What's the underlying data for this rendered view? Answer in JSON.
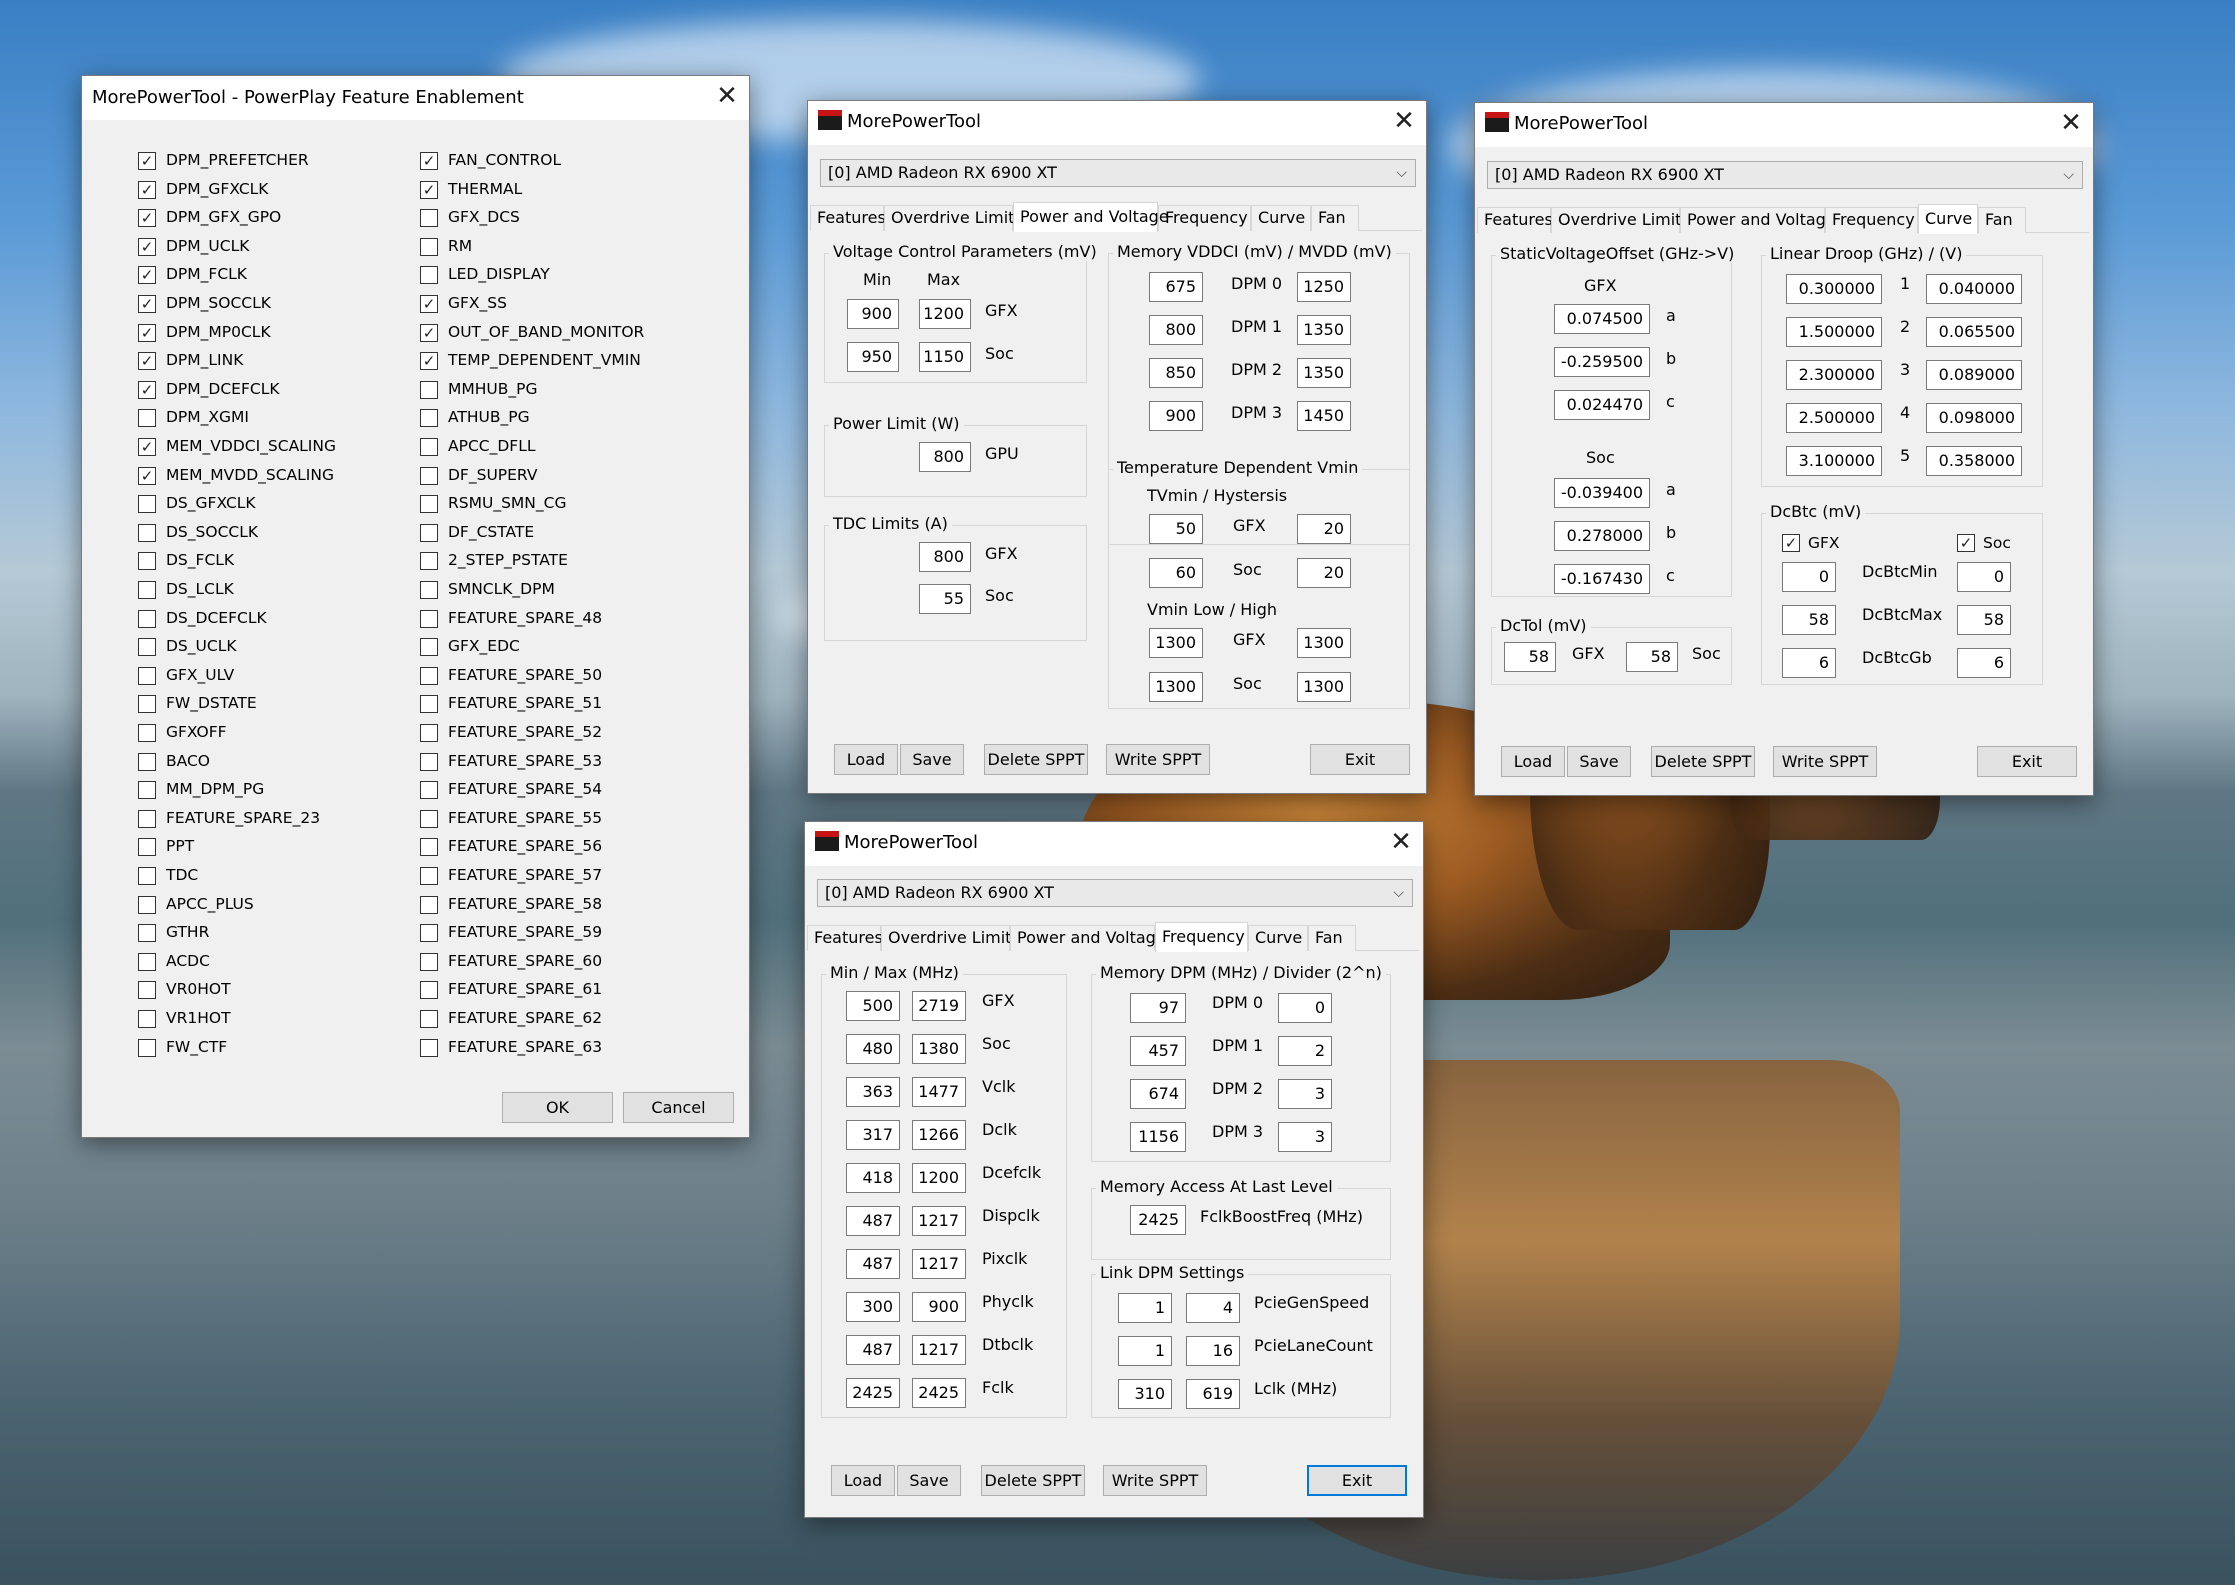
{
  "feat": {
    "title": "MorePowerTool - PowerPlay Feature Enablement",
    "ok": "OK",
    "cancel": "Cancel",
    "left": [
      [
        "DPM_PREFETCHER",
        true
      ],
      [
        "DPM_GFXCLK",
        true
      ],
      [
        "DPM_GFX_GPO",
        true
      ],
      [
        "DPM_UCLK",
        true
      ],
      [
        "DPM_FCLK",
        true
      ],
      [
        "DPM_SOCCLK",
        true
      ],
      [
        "DPM_MP0CLK",
        true
      ],
      [
        "DPM_LINK",
        true
      ],
      [
        "DPM_DCEFCLK",
        true
      ],
      [
        "DPM_XGMI",
        false
      ],
      [
        "MEM_VDDCI_SCALING",
        true
      ],
      [
        "MEM_MVDD_SCALING",
        true
      ],
      [
        "DS_GFXCLK",
        false
      ],
      [
        "DS_SOCCLK",
        false
      ],
      [
        "DS_FCLK",
        false
      ],
      [
        "DS_LCLK",
        false
      ],
      [
        "DS_DCEFCLK",
        false
      ],
      [
        "DS_UCLK",
        false
      ],
      [
        "GFX_ULV",
        false
      ],
      [
        "FW_DSTATE",
        false
      ],
      [
        "GFXOFF",
        false
      ],
      [
        "BACO",
        false
      ],
      [
        "MM_DPM_PG",
        false
      ],
      [
        "FEATURE_SPARE_23",
        false
      ],
      [
        "PPT",
        false
      ],
      [
        "TDC",
        false
      ],
      [
        "APCC_PLUS",
        false
      ],
      [
        "GTHR",
        false
      ],
      [
        "ACDC",
        false
      ],
      [
        "VR0HOT",
        false
      ],
      [
        "VR1HOT",
        false
      ],
      [
        "FW_CTF",
        false
      ]
    ],
    "right": [
      [
        "FAN_CONTROL",
        true
      ],
      [
        "THERMAL",
        true
      ],
      [
        "GFX_DCS",
        false
      ],
      [
        "RM",
        false
      ],
      [
        "LED_DISPLAY",
        false
      ],
      [
        "GFX_SS",
        true
      ],
      [
        "OUT_OF_BAND_MONITOR",
        true
      ],
      [
        "TEMP_DEPENDENT_VMIN",
        true
      ],
      [
        "MMHUB_PG",
        false
      ],
      [
        "ATHUB_PG",
        false
      ],
      [
        "APCC_DFLL",
        false
      ],
      [
        "DF_SUPERV",
        false
      ],
      [
        "RSMU_SMN_CG",
        false
      ],
      [
        "DF_CSTATE",
        false
      ],
      [
        "2_STEP_PSTATE",
        false
      ],
      [
        "SMNCLK_DPM",
        false
      ],
      [
        "FEATURE_SPARE_48",
        false
      ],
      [
        "GFX_EDC",
        false
      ],
      [
        "FEATURE_SPARE_50",
        false
      ],
      [
        "FEATURE_SPARE_51",
        false
      ],
      [
        "FEATURE_SPARE_52",
        false
      ],
      [
        "FEATURE_SPARE_53",
        false
      ],
      [
        "FEATURE_SPARE_54",
        false
      ],
      [
        "FEATURE_SPARE_55",
        false
      ],
      [
        "FEATURE_SPARE_56",
        false
      ],
      [
        "FEATURE_SPARE_57",
        false
      ],
      [
        "FEATURE_SPARE_58",
        false
      ],
      [
        "FEATURE_SPARE_59",
        false
      ],
      [
        "FEATURE_SPARE_60",
        false
      ],
      [
        "FEATURE_SPARE_61",
        false
      ],
      [
        "FEATURE_SPARE_62",
        false
      ],
      [
        "FEATURE_SPARE_63",
        false
      ]
    ]
  },
  "common": {
    "app": "MorePowerTool",
    "gpu": "[0] AMD Radeon RX 6900 XT",
    "tabs": [
      "Features",
      "Overdrive Limits",
      "Power and Voltage",
      "Frequency",
      "Curve",
      "Fan"
    ],
    "load": "Load",
    "save": "Save",
    "del": "Delete SPPT",
    "write": "Write SPPT",
    "exit": "Exit"
  },
  "pv": {
    "vcp": {
      "cap": "Voltage Control Parameters (mV)",
      "min": "Min",
      "max": "Max",
      "gfx": "GFX",
      "soc": "Soc",
      "gfx_min": "900",
      "gfx_max": "1200",
      "soc_min": "950",
      "soc_max": "1150"
    },
    "pl": {
      "cap": "Power Limit (W)",
      "val": "800",
      "lbl": "GPU"
    },
    "tdc": {
      "cap": "TDC Limits (A)",
      "gfx": "800",
      "soc": "55",
      "gfxl": "GFX",
      "socl": "Soc"
    },
    "mem": {
      "cap": "Memory VDDCI (mV) / MVDD (mV)",
      "rows": [
        [
          "675",
          "DPM 0",
          "1250"
        ],
        [
          "800",
          "DPM 1",
          "1350"
        ],
        [
          "850",
          "DPM 2",
          "1350"
        ],
        [
          "900",
          "DPM 3",
          "1450"
        ]
      ]
    },
    "tdv": {
      "cap": "Temperature Dependent Vmin",
      "sub1": "TVmin / Hystersis",
      "sub2": "Vmin Low / High",
      "r1": [
        "50",
        "GFX",
        "20"
      ],
      "r2": [
        "60",
        "Soc",
        "20"
      ],
      "r3": [
        "1300",
        "GFX",
        "1300"
      ],
      "r4": [
        "1300",
        "Soc",
        "1300"
      ]
    }
  },
  "curve": {
    "svo": {
      "cap": "StaticVoltageOffset (GHz->V)",
      "gfx": "GFX",
      "soc": "Soc",
      "g": [
        [
          "0.074500",
          "a"
        ],
        [
          "-0.259500",
          "b"
        ],
        [
          "0.024470",
          "c"
        ]
      ],
      "s": [
        [
          "-0.039400",
          "a"
        ],
        [
          "0.278000",
          "b"
        ],
        [
          "-0.167430",
          "c"
        ]
      ]
    },
    "ld": {
      "cap": "Linear Droop (GHz) / (V)",
      "rows": [
        [
          "0.300000",
          "1",
          "0.040000"
        ],
        [
          "1.500000",
          "2",
          "0.065500"
        ],
        [
          "2.300000",
          "3",
          "0.089000"
        ],
        [
          "2.500000",
          "4",
          "0.098000"
        ],
        [
          "3.100000",
          "5",
          "0.358000"
        ]
      ]
    },
    "dcbtc": {
      "cap": "DcBtc (mV)",
      "gfx": "GFX",
      "soc": "Soc",
      "rows": [
        [
          "0",
          "DcBtcMin",
          "0"
        ],
        [
          "58",
          "DcBtcMax",
          "58"
        ],
        [
          "6",
          "DcBtcGb",
          "6"
        ]
      ]
    },
    "dctol": {
      "cap": "DcTol (mV)",
      "gfx": "58",
      "gfxl": "GFX",
      "soc": "58",
      "socl": "Soc"
    }
  },
  "freq": {
    "mm": {
      "cap": "Min / Max (MHz)",
      "rows": [
        [
          "500",
          "2719",
          "GFX"
        ],
        [
          "480",
          "1380",
          "Soc"
        ],
        [
          "363",
          "1477",
          "Vclk"
        ],
        [
          "317",
          "1266",
          "Dclk"
        ],
        [
          "418",
          "1200",
          "Dcefclk"
        ],
        [
          "487",
          "1217",
          "Dispclk"
        ],
        [
          "487",
          "1217",
          "Pixclk"
        ],
        [
          "300",
          "900",
          "Phyclk"
        ],
        [
          "487",
          "1217",
          "Dtbclk"
        ],
        [
          "2425",
          "2425",
          "Fclk"
        ]
      ]
    },
    "mdpm": {
      "cap": "Memory DPM (MHz) / Divider (2^n)",
      "rows": [
        [
          "97",
          "DPM 0",
          "0"
        ],
        [
          "457",
          "DPM 1",
          "2"
        ],
        [
          "674",
          "DPM 2",
          "3"
        ],
        [
          "1156",
          "DPM 3",
          "3"
        ]
      ]
    },
    "mal": {
      "cap": "Memory Access At Last Level",
      "val": "2425",
      "lbl": "FclkBoostFreq (MHz)"
    },
    "link": {
      "cap": "Link DPM Settings",
      "rows": [
        [
          "1",
          "4",
          "PcieGenSpeed"
        ],
        [
          "1",
          "16",
          "PcieLaneCount"
        ],
        [
          "310",
          "619",
          "Lclk (MHz)"
        ]
      ]
    }
  }
}
